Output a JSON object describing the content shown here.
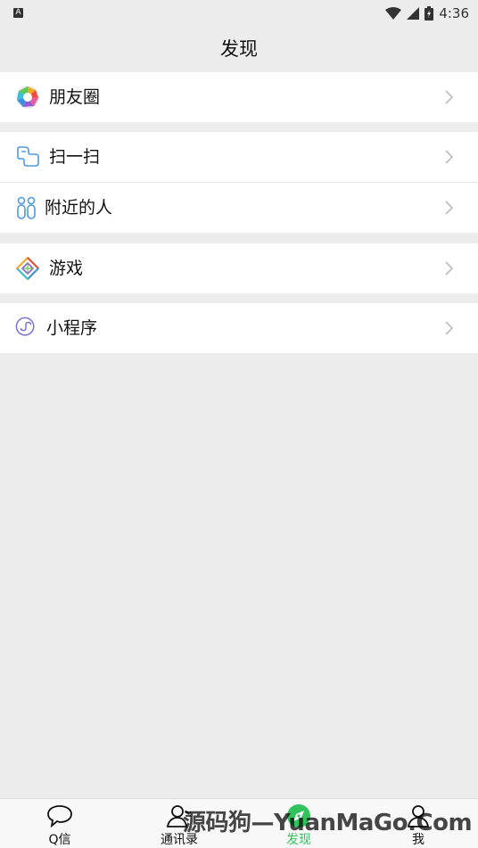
{
  "status_bar": {
    "badge": "A",
    "time": "4:36"
  },
  "header": {
    "title": "发现"
  },
  "menu": {
    "moments": {
      "label": "朋友圈",
      "icon": "moments-icon"
    },
    "scan": {
      "label": "扫一扫",
      "icon": "scan-icon"
    },
    "nearby": {
      "label": "附近的人",
      "icon": "people-nearby-icon"
    },
    "games": {
      "label": "游戏",
      "icon": "games-icon"
    },
    "mini_programs": {
      "label": "小程序",
      "icon": "mini-program-icon"
    }
  },
  "tabbar": {
    "tabs": [
      {
        "label": "Q信",
        "icon": "chat-bubble-icon"
      },
      {
        "label": "通讯录",
        "icon": "contacts-icon"
      },
      {
        "label": "发现",
        "icon": "compass-icon",
        "active": true
      },
      {
        "label": "我",
        "icon": "person-icon"
      }
    ]
  },
  "watermark": {
    "text": "源码狗—YuanMaGo.Com"
  },
  "colors": {
    "accent": "#31c25e",
    "background": "#ececec"
  }
}
